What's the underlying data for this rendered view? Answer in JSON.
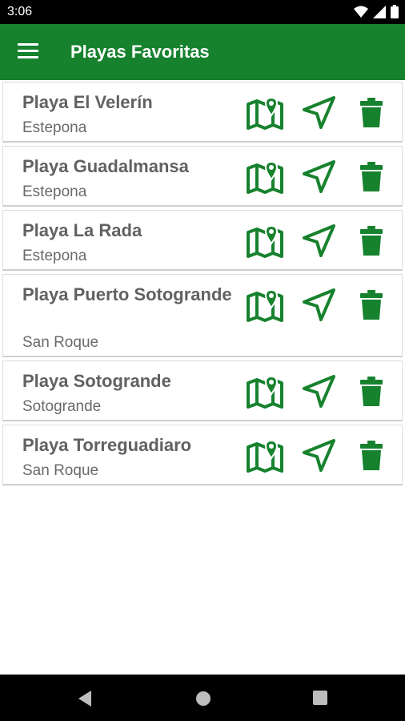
{
  "status": {
    "time": "3:06"
  },
  "appbar": {
    "title": "Playas Favoritas"
  },
  "beaches": [
    {
      "name": "Playa El Velerín",
      "town": "Estepona"
    },
    {
      "name": "Playa Guadalmansa",
      "town": "Estepona"
    },
    {
      "name": "Playa La Rada",
      "town": "Estepona"
    },
    {
      "name": "Playa Puerto Sotogrande",
      "town": "San Roque"
    },
    {
      "name": "Playa Sotogrande",
      "town": "Sotogrande"
    },
    {
      "name": "Playa Torreguadiaro",
      "town": "San Roque"
    }
  ],
  "icons": {
    "menu": "menu-icon",
    "map": "map-pin-icon",
    "navigate": "navigation-arrow-icon",
    "delete": "trash-icon"
  },
  "colors": {
    "primary": "#17822e",
    "icon_green": "#17822e"
  }
}
